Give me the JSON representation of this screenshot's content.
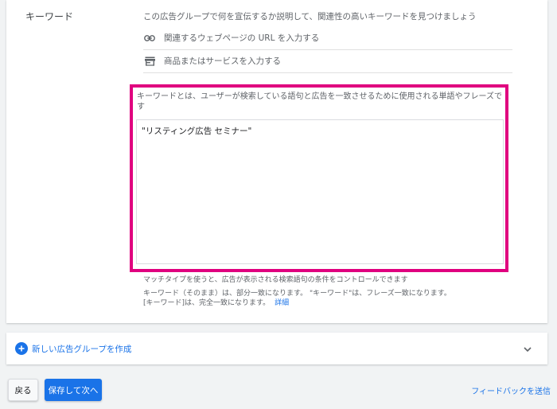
{
  "keywords_section": {
    "label": "キーワード",
    "intro": "この広告グループで何を宣伝するか説明して、関連性の高いキーワードを見つけましょう",
    "url_placeholder": "関連するウェブページの URL を入力する",
    "product_placeholder": "商品またはサービスを入力する",
    "description": "キーワードとは、ユーザーが検索している語句と広告を一致させるために使用される単語やフレーズです",
    "keyword_value": "\"リスティング広告 セミナー\"",
    "hint_line1": "マッチタイプを使うと、広告が表示される検索語句の条件をコントロールできます",
    "hint_line2": "キーワード（そのまま）は、部分一致になります。 \"キーワード\"は、フレーズ一致になります。",
    "hint_line3": "[キーワード]は、完全一致になります。",
    "details_link": "詳細"
  },
  "ad_group": {
    "new_label": "新しい広告グループを作成"
  },
  "footer": {
    "back_label": "戻る",
    "save_next_label": "保存して次へ",
    "feedback_label": "フィードバックを送信"
  },
  "colors": {
    "accent": "#1a73e8",
    "highlight": "#e0007f"
  },
  "icons": {
    "url": "link-icon",
    "product": "store-icon",
    "add": "add-circle-icon",
    "expand": "chevron-down-icon"
  }
}
